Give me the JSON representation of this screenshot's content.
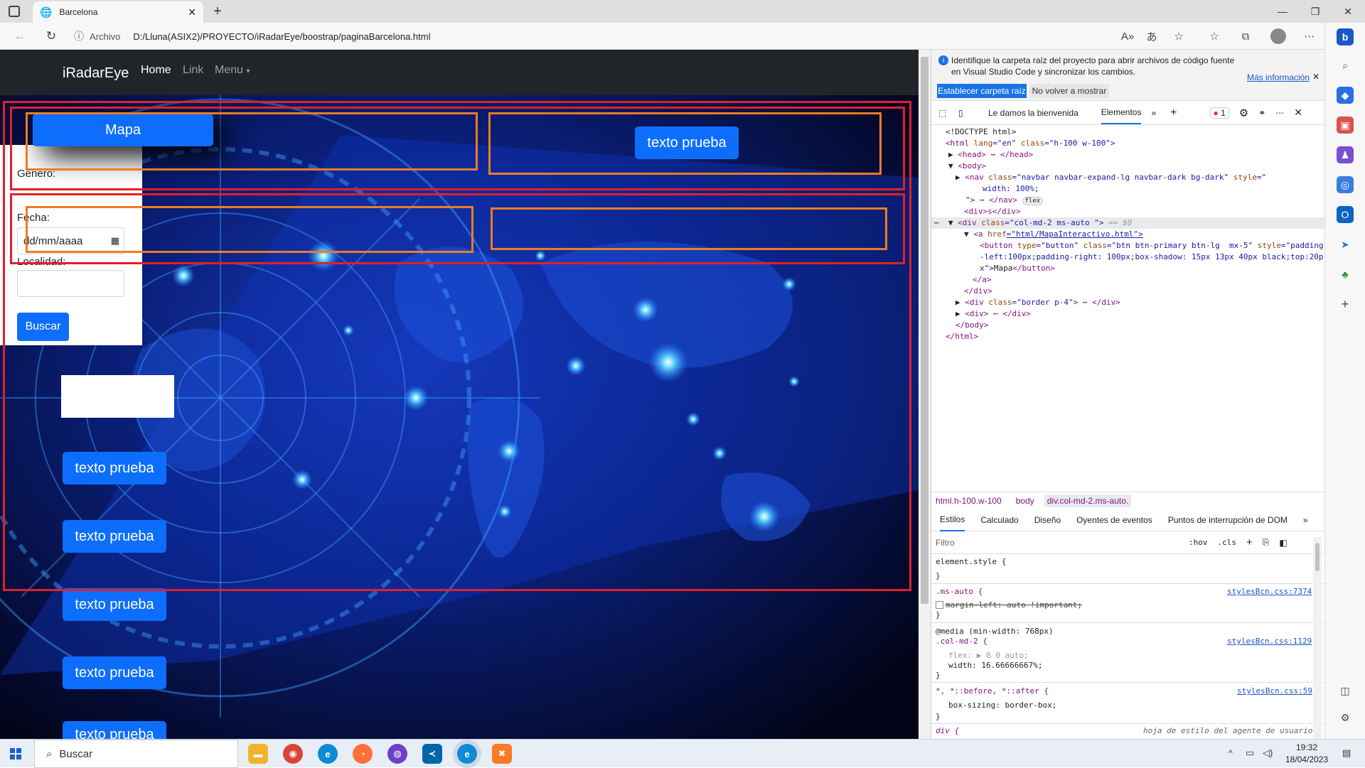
{
  "browser": {
    "tab_title": "Barcelona",
    "url_label": "Archivo",
    "url": "D:/Lluna(ASIX2)/PROYECTO/iRadarEye/boostrap/paginaBarcelona.html"
  },
  "site": {
    "brand": "iRadarEye",
    "nav": [
      "Home",
      "Link",
      "Menu"
    ],
    "form": {
      "genero_label": "Genero:",
      "fecha_label": "Fecha:",
      "fecha_placeholder": "dd/mm/aaaa",
      "localidad_label": "Localidad:",
      "buscar": "Buscar"
    },
    "mapa_button": "Mapa",
    "texto_prueba": "texto prueba"
  },
  "devtools": {
    "banner_text_1": "Identifique la carpeta raíz del proyecto para abrir archivos de código fuente",
    "banner_text_2": "en Visual Studio Code y sincronizar los cambios.",
    "banner_link": "Más información",
    "banner_btn_1": "Establecer carpeta raíz",
    "banner_btn_2": "No volver a mostrar",
    "tab_welcome": "Le damos la bienvenida",
    "tab_elements": "Elementos",
    "error_count": "1",
    "dom": {
      "l1": "<!DOCTYPE html>",
      "l2a": "<html ",
      "l2b": "lang",
      "l2c": "=\"en\" ",
      "l2d": "class",
      "l2e": "=\"h-100 w-100\">",
      "l3": "<head>",
      "l3b": "</head>",
      "l4": "<body>",
      "l5a": "<nav ",
      "l5b": "class",
      "l5c": "=\"navbar navbar-expand-lg navbar-dark bg-dark\" ",
      "l5d": "style",
      "l5e": "=\"",
      "l6": "width: 100%;",
      "l7a": "\">",
      "l7b": "</nav>",
      "l7c": "flex",
      "l8": "<div>s</div>",
      "l9a": "<div ",
      "l9b": "class",
      "l9c": "=\"col-md-2 ms-auto \">",
      "l9d": "== $0",
      "l10a": "<a ",
      "l10b": "href",
      "l10c": "=\"html/MapaInteractivo.html\">",
      "l11a": "<button ",
      "l11b": "type",
      "l11c": "=\"button\" ",
      "l11d": "class",
      "l11e": "=\"btn btn-primary btn-lg  mx-5\" ",
      "l11f": "style",
      "l11g": "=\"padding",
      "l12": "-left:100px;padding-right: 100px;box-shadow: 15px 13px 40px black;top:20p",
      "l13a": "x\">",
      "l13b": "Mapa",
      "l13c": "</button>",
      "l14": "</a>",
      "l15": "</div>",
      "l16a": "<div ",
      "l16b": "class",
      "l16c": "=\"border p-4\">",
      "l16d": "</div>",
      "l17a": "<div>",
      "l17b": "</div>",
      "l18": "</body>",
      "l19": "</html>"
    },
    "crumbs": [
      "html.h-100.w-100",
      "body",
      "div.col-md-2.ms-auto."
    ],
    "subtabs": [
      "Estilos",
      "Calculado",
      "Diseño",
      "Oyentes de eventos",
      "Puntos de interrupción de DOM"
    ],
    "filter_placeholder": "Filtro",
    "hov": ":hov",
    "cls": ".cls",
    "styles": {
      "s1": "element.style {",
      "close": "}",
      "s2": ".ms-auto {",
      "s2src": "stylesBcn.css:7374",
      "s2prop": "margin-left: auto !important;",
      "s3": "@media (min-width: 768px)",
      "s3b": ".col-md-2 {",
      "s3src": "stylesBcn.css:1129",
      "s3p1": "flex: ▶ 0 0 auto;",
      "s3p2": "width: 16.66666667%;",
      "s4": "*, *::before, *::after {",
      "s4src": "stylesBcn.css:59",
      "s4p": "box-sizing: border-box;",
      "s5": "div {",
      "s5src": "hoja de estilo del agente de usuario"
    }
  },
  "taskbar": {
    "search": "Buscar",
    "time": "19:32",
    "date": "18/04/2023"
  }
}
